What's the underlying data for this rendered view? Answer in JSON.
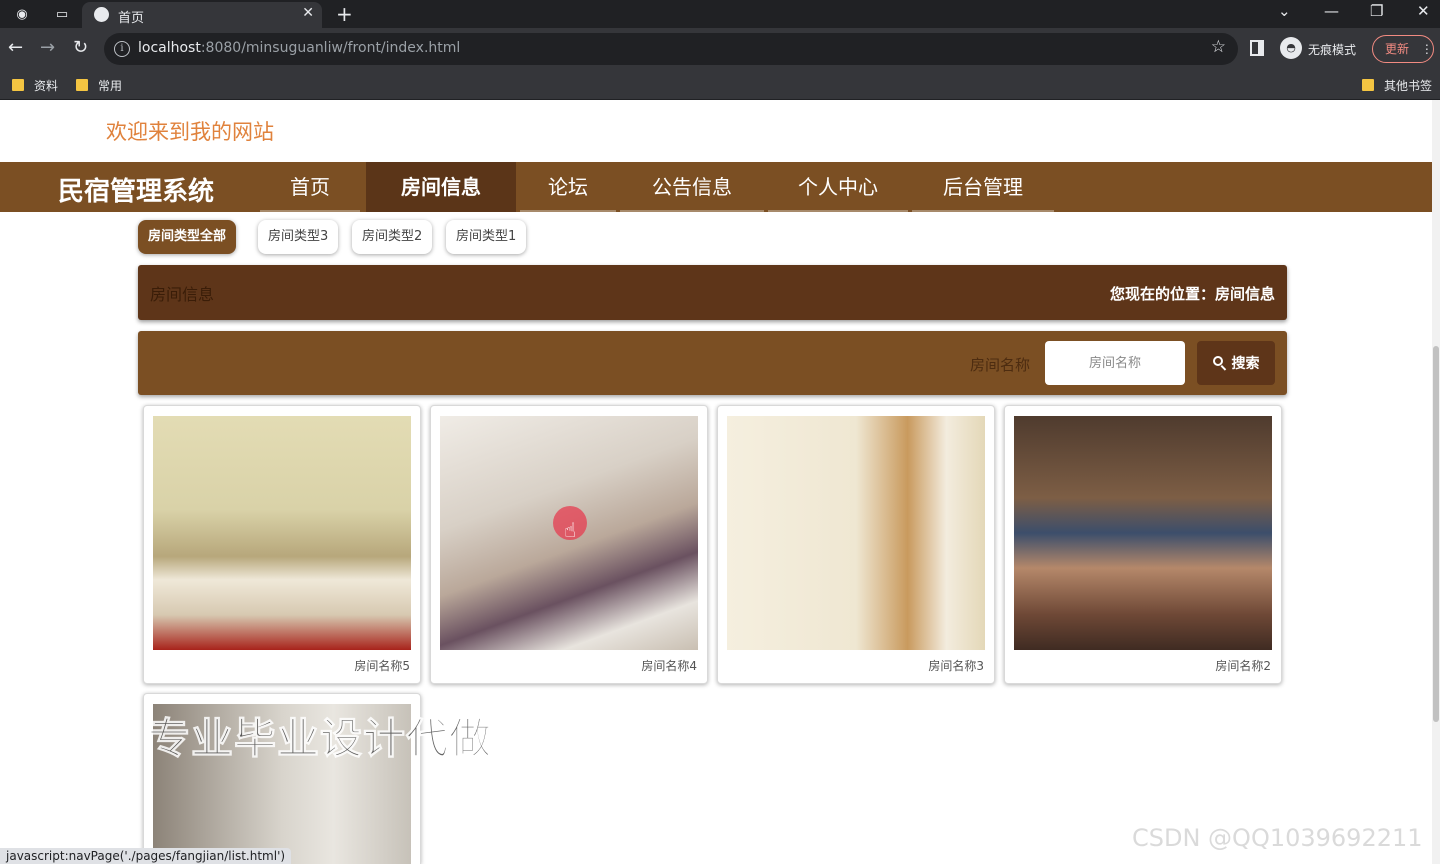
{
  "browser": {
    "tab_title": "首页",
    "url_host": "localhost",
    "url_rest": ":8080/minsuguanliw/front/index.html",
    "incognito_label": "无痕模式",
    "update_label": "更新",
    "bookmarks": [
      "资料",
      "常用"
    ],
    "other_bookmarks": "其他书签",
    "status_url": "javascript:navPage('./pages/fangjian/list.html')"
  },
  "site": {
    "welcome": "欢迎来到我的网站",
    "brand": "民宿管理系统",
    "nav": [
      {
        "label": "首页"
      },
      {
        "label": "房间信息"
      },
      {
        "label": "论坛"
      },
      {
        "label": "公告信息"
      },
      {
        "label": "个人中心"
      },
      {
        "label": "后台管理"
      }
    ],
    "categories": [
      "房间类型全部",
      "房间类型3",
      "房间类型2",
      "房间类型1"
    ],
    "breadcrumb": {
      "left": "房间信息",
      "right": "您现在的位置：房间信息"
    },
    "search": {
      "label": "房间名称",
      "placeholder": "房间名称",
      "button": "搜索"
    },
    "rooms": [
      {
        "name": "房间名称5"
      },
      {
        "name": "房间名称4"
      },
      {
        "name": "房间名称3"
      },
      {
        "name": "房间名称2"
      },
      {
        "name": ""
      }
    ],
    "watermark": "专业毕业设计代做",
    "csdn": "CSDN @QQ1039692211"
  },
  "colors": {
    "nav_brown": "#7b4f23",
    "dark_brown": "#5e3519",
    "welcome_orange": "#e0823c"
  }
}
